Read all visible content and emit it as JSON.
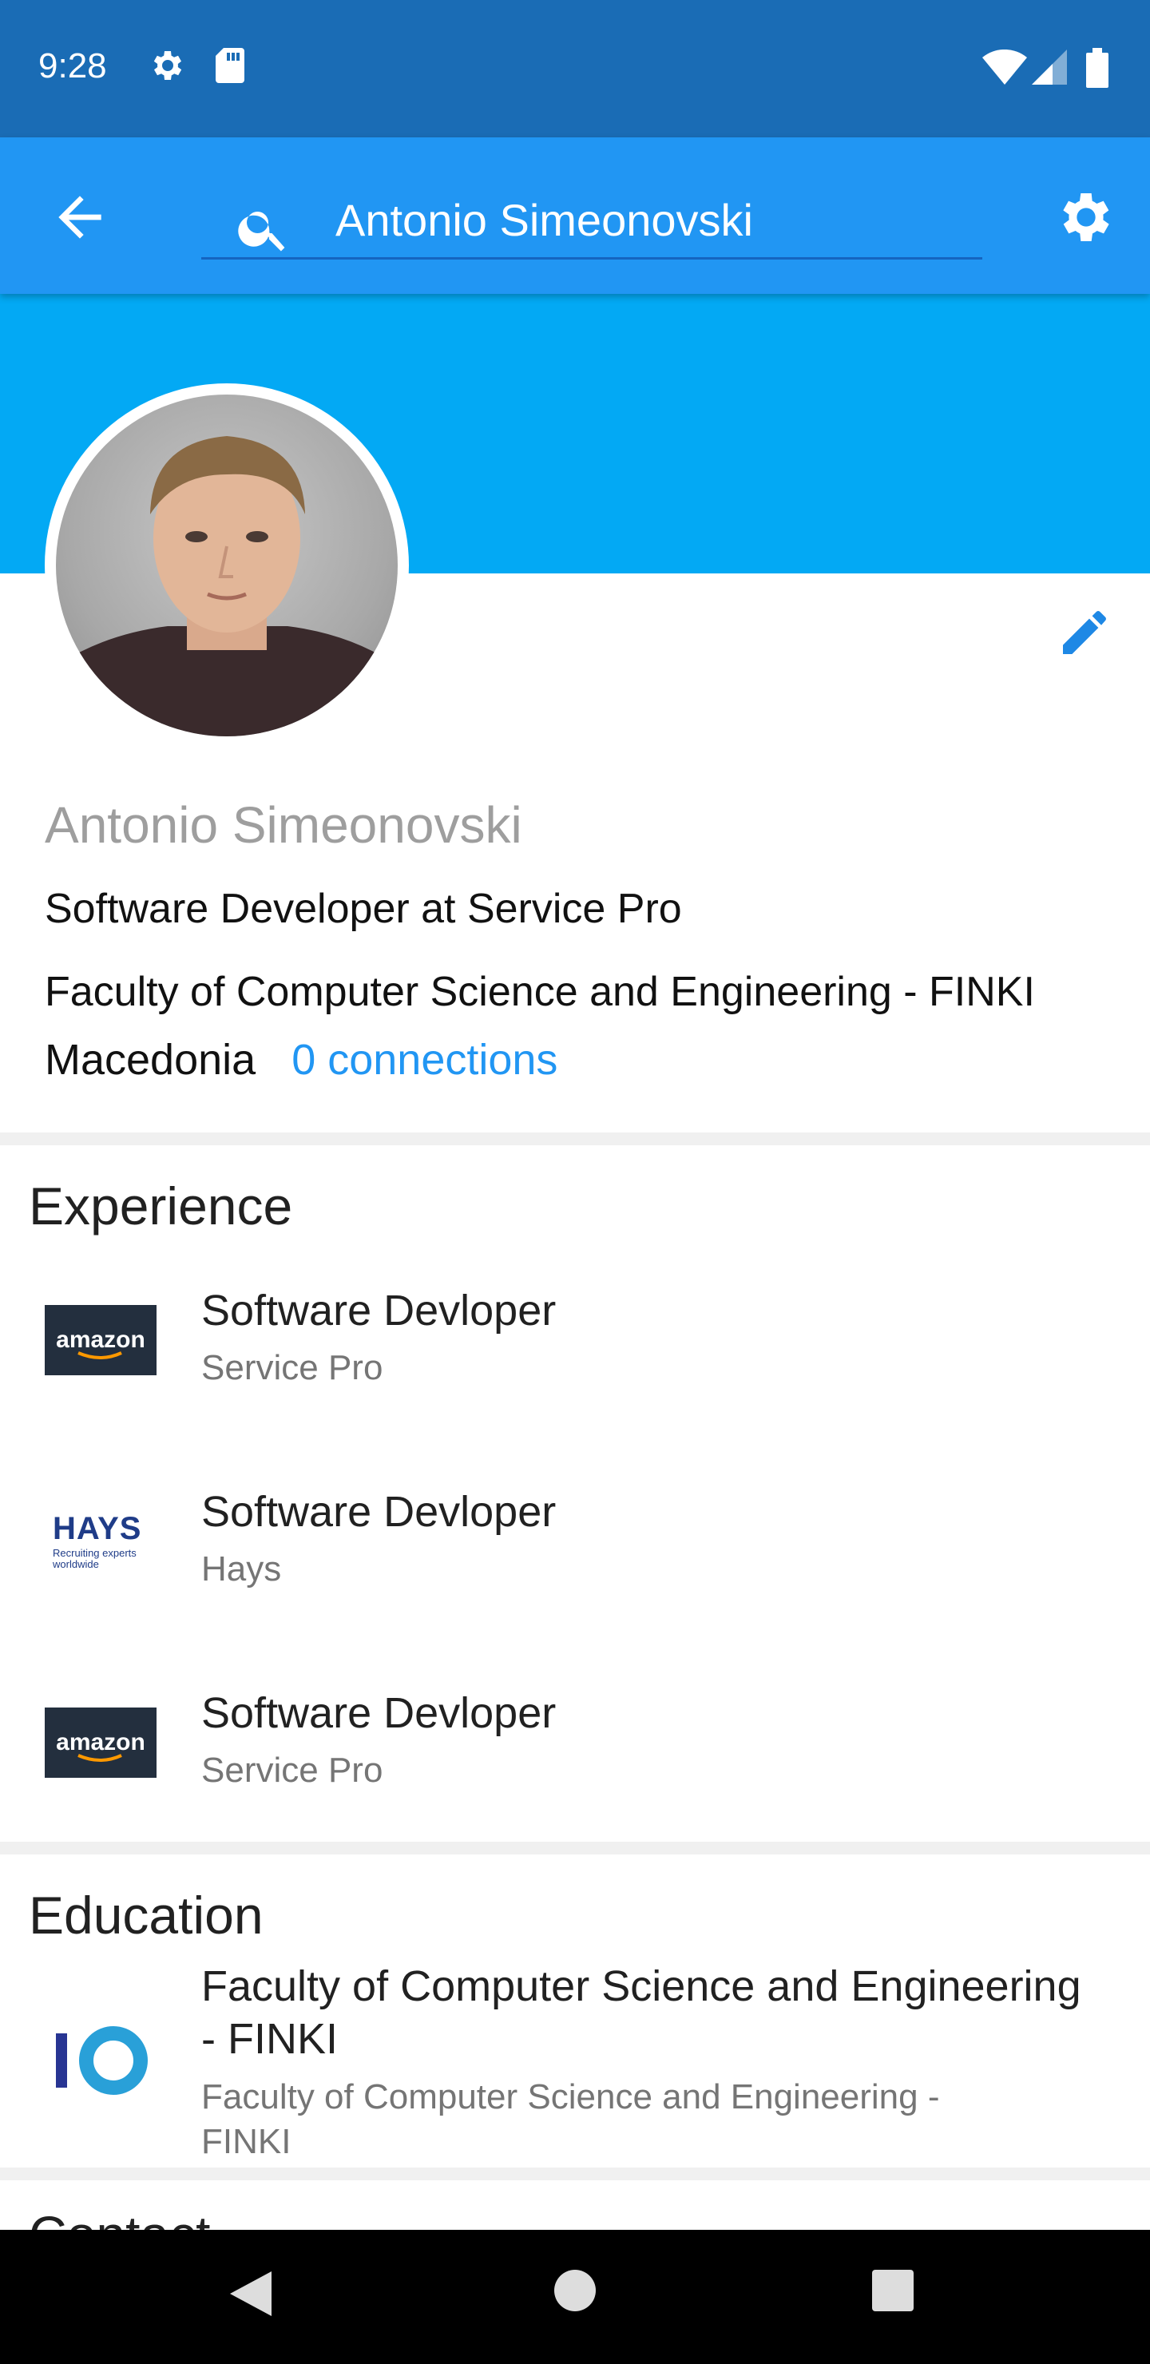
{
  "status_bar": {
    "time": "9:28",
    "icons": [
      "settings-icon",
      "sd-card-icon",
      "wifi-icon",
      "signal-icon",
      "battery-icon"
    ]
  },
  "app_bar": {
    "back_icon": "arrow-back-icon",
    "search": {
      "value": "Antonio Simeonovski",
      "icon": "search-icon"
    },
    "settings_icon": "gear-icon"
  },
  "profile": {
    "name": "Antonio Simeonovski",
    "headline": "Software Developer at Service Pro",
    "school": "Faculty of Computer Science and Engineering - FINKI",
    "location": "Macedonia",
    "connections": "0 connections",
    "edit_icon": "pencil-icon"
  },
  "experience": {
    "title": "Experience",
    "items": [
      {
        "title": "Software Devloper",
        "company": "Service Pro",
        "logo": "amazon",
        "logo_text": "amazon"
      },
      {
        "title": "Software Devloper",
        "company": "Hays",
        "logo": "hays",
        "logo_text": "HAYS",
        "logo_tagline_1": "Recruiting experts",
        "logo_tagline_2": "worldwide"
      },
      {
        "title": "Software Devloper",
        "company": "Service Pro",
        "logo": "amazon",
        "logo_text": "amazon"
      }
    ]
  },
  "education": {
    "title": "Education",
    "items": [
      {
        "title_line1": "Faculty of Computer Science and Engineering",
        "title_line2": "- FINKI",
        "sub_line1": "Faculty of Computer Science and Engineering -",
        "sub_line2": "FINKI"
      }
    ]
  },
  "next_section_partial": "Contact",
  "nav_bar": {
    "buttons": [
      "back-triangle-icon",
      "home-circle-icon",
      "recents-square-icon"
    ]
  },
  "colors": {
    "status_bar": "#1a6cb5",
    "app_bar": "#2196f3",
    "cover": "#03a9f4",
    "link": "#2196f3"
  }
}
